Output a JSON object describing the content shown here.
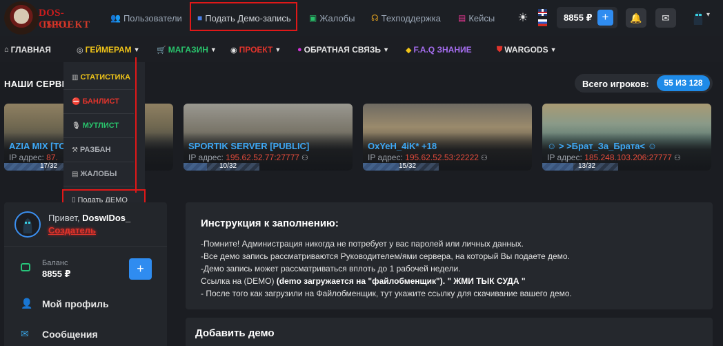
{
  "logo": {
    "line1": "DOS-CS.RU",
    "line2": "ПРОЕКТ"
  },
  "topnav": {
    "users": "Пользователи",
    "submit_demo": "Подать Демо-запись",
    "complaints": "Жалобы",
    "support": "Техподдержка",
    "cases": "Кейсы"
  },
  "header": {
    "balance": "8855 ₽",
    "plus": "+"
  },
  "mainnav": {
    "home": "ГЛАВНАЯ",
    "gamers": "ГЕЙМЕРАМ",
    "shop": "МАГАЗИН",
    "project": "ПРОЕКТ",
    "feedback": "ОБРАТНАЯ СВЯЗЬ",
    "faq": "F.A.Q ЗНАНИЕ",
    "wargods": "WARGODS"
  },
  "dropdown": {
    "stats": "СТАТИСТИКА",
    "banlist": "БАНЛИСТ",
    "mutelist": "МУТЛИСТ",
    "unban": "РАЗБАН",
    "complaints": "ЖАЛОБЫ",
    "submit_demo": "Подать ДЕМО"
  },
  "servers": {
    "heading": "НАШИ СЕРВЕРЫ",
    "players_label": "Всего игроков:",
    "players_value": "55 ИЗ 128",
    "ip_label": "IP адрес:",
    "cards": [
      {
        "name": "AZIA MIX [TOP]",
        "ip": "87.",
        "count": "17/32",
        "fill": 0.53
      },
      {
        "name": "SPORTIK SERVER [PUBLIC]",
        "ip": "195.62.52.77:27777",
        "count": "10/32",
        "fill": 0.31
      },
      {
        "name": "OxYeH_4iK* +18",
        "ip": "195.62.52.53:22222",
        "count": "15/32",
        "fill": 0.47
      },
      {
        "name": "☺ > >Брат_За_Брата< ☺",
        "ip": "185.248.103.206:27777",
        "count": "13/32",
        "fill": 0.41
      }
    ]
  },
  "profile": {
    "hello": "Привет,",
    "username": "DoswIDos_",
    "role": "Создатель",
    "balance_label": "Баланс",
    "balance_value": "8855 ₽",
    "plus": "+",
    "my_profile": "Мой профиль",
    "messages": "Сообщения"
  },
  "instructions": {
    "title": "Инструкция к заполнению:",
    "line1": "-Помните! Администрация никогда не потребует у вас паролей или личных данных.",
    "line2": "-Все демо запись рассматриваются Руководителем/ями сервера, на который Вы подаете демо.",
    "line3": "-Демо запись может рассматриваться вплоть до 1 рабочей недели.",
    "line4_prefix": "Ссылка на (DEMO)",
    "line4_bold": "(demo загружается на \"файлобменщик\"). \" ЖМИ ТЫК СУДА \"",
    "line5": "- После того как загрузили на Файлобменщик, тут укажите ссылку для скачивание вашего демо."
  },
  "add_demo": {
    "title": "Добавить демо"
  },
  "colors": {
    "accent": "#2f8cf0",
    "highlight": "#e01818"
  }
}
